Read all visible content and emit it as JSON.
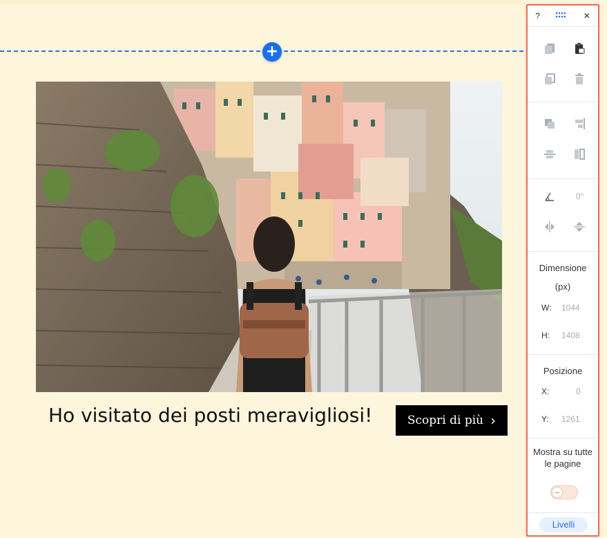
{
  "canvas": {
    "add_section_symbol": "+",
    "headline": "Ho visitato dei posti meravigliosi!",
    "cta_label": "Scopri di più",
    "cta_chevron": "›"
  },
  "panel": {
    "help_label": "?",
    "close_label": "✕",
    "rotation_value": "0°",
    "dimension_title": "Dimensione",
    "dimension_unit": "(px)",
    "w_label": "W:",
    "w_value": "1044",
    "h_label": "H:",
    "h_value": "1408",
    "position_title": "Posizione",
    "x_label": "X:",
    "x_value": "0",
    "y_label": "Y:",
    "y_value": "1261",
    "show_all_pages_label": "Mostra su tutte le pagine",
    "layers_label": "Livelli",
    "icons": [
      "copy-style-icon",
      "paste-icon",
      "duplicate-icon",
      "delete-icon",
      "arrange-icon",
      "align-icon",
      "distribute-icon",
      "match-size-icon",
      "rotate-icon",
      "flip-horizontal-icon",
      "flip-vertical-icon",
      "grid-dots-icon"
    ]
  },
  "colors": {
    "accent": "#1a6ef0",
    "panel_border": "#e8705a",
    "canvas_bg": "#fdf5dc"
  }
}
